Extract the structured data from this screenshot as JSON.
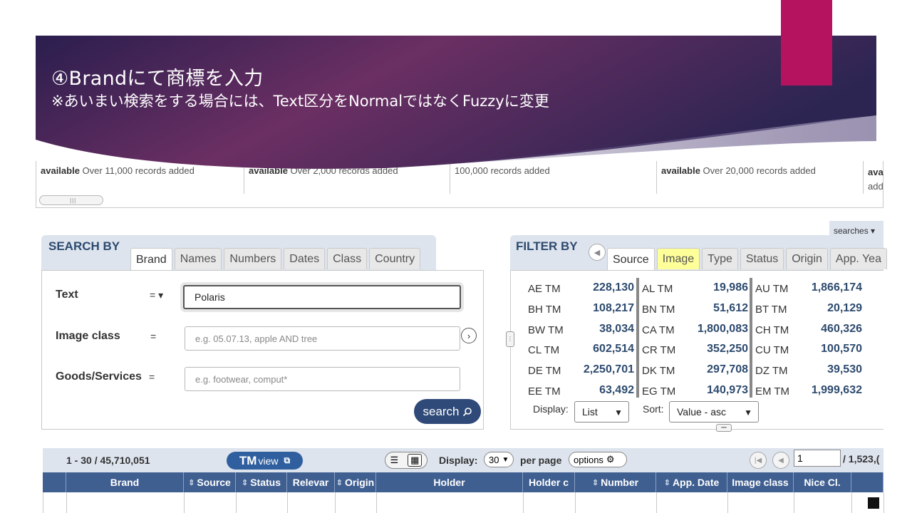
{
  "slide": {
    "title": "④Brandにて商標を入力",
    "subtitle": "※あいまい検索をする場合には、Text区分をNormalではなくFuzzyに変更",
    "accent_color": "#b5135f",
    "banner_colors": [
      "#2a1e4e",
      "#6b2f63"
    ]
  },
  "collections_strip": {
    "cells": [
      {
        "bold": "available",
        "rest": " Over 11,000 records added"
      },
      {
        "bold": "available",
        "rest": " Over 2,000 records added"
      },
      {
        "bold": "",
        "rest": "100,000 records added"
      },
      {
        "bold": "available",
        "rest": " Over 20,000 records added"
      },
      {
        "bold": "ava",
        "rest": "\nadd"
      }
    ],
    "scroll_handle": "|||"
  },
  "search": {
    "heading": "SEARCH BY",
    "tabs": [
      "Brand",
      "Names",
      "Numbers",
      "Dates",
      "Class",
      "Country"
    ],
    "active_tab": "Brand",
    "fields": {
      "text": {
        "label": "Text",
        "operator": "= ▾",
        "value": "Polaris"
      },
      "image_class": {
        "label": "Image class",
        "operator": "=",
        "placeholder": "e.g. 05.07.13, apple AND tree"
      },
      "goods_services": {
        "label": "Goods/Services",
        "operator": "=",
        "placeholder": "e.g. footwear, comput*"
      }
    },
    "search_button": "search",
    "search_icon": "magnifier-icon"
  },
  "filter": {
    "heading": "FILTER BY",
    "searches_label": "searches",
    "tabs": [
      "Source",
      "Image",
      "Type",
      "Status",
      "Origin",
      "App. Yea"
    ],
    "active_tab": "Source",
    "highlight_tab": "Image",
    "rows": [
      [
        {
          "code": "AE TM",
          "count": "228,130"
        },
        {
          "code": "AL TM",
          "count": "19,986"
        },
        {
          "code": "AU TM",
          "count": "1,866,174"
        }
      ],
      [
        {
          "code": "BH TM",
          "count": "108,217"
        },
        {
          "code": "BN TM",
          "count": "51,612"
        },
        {
          "code": "BT TM",
          "count": "20,129"
        }
      ],
      [
        {
          "code": "BW TM",
          "count": "38,034"
        },
        {
          "code": "CA TM",
          "count": "1,800,083"
        },
        {
          "code": "CH TM",
          "count": "460,326"
        }
      ],
      [
        {
          "code": "CL TM",
          "count": "602,514"
        },
        {
          "code": "CR TM",
          "count": "352,250"
        },
        {
          "code": "CU TM",
          "count": "100,570"
        }
      ],
      [
        {
          "code": "DE TM",
          "count": "2,250,701"
        },
        {
          "code": "DK TM",
          "count": "297,708"
        },
        {
          "code": "DZ TM",
          "count": "39,530"
        }
      ],
      [
        {
          "code": "EE TM",
          "count": "63,492"
        },
        {
          "code": "EG TM",
          "count": "140,973"
        },
        {
          "code": "EM TM",
          "count": "1,999,632"
        }
      ]
    ],
    "display_label": "Display:",
    "display_value": "List",
    "sort_label": "Sort:",
    "sort_value": "Value - asc"
  },
  "results": {
    "range": "1 - 30 / 45,710,051",
    "tmview_tm": "TM",
    "tmview_view": "view",
    "display_label": "Display:",
    "per_page_value": "30",
    "per_page_label": "per page",
    "options_label": "options",
    "page_value": "1",
    "total_pages": "/ 1,523,("
  },
  "table": {
    "columns": [
      "",
      "Brand",
      "Source",
      "Status",
      "Relevar",
      "Origin",
      "Holder",
      "Holder c",
      "Number",
      "App. Date",
      "Image class",
      "Nice Cl.",
      ""
    ]
  }
}
